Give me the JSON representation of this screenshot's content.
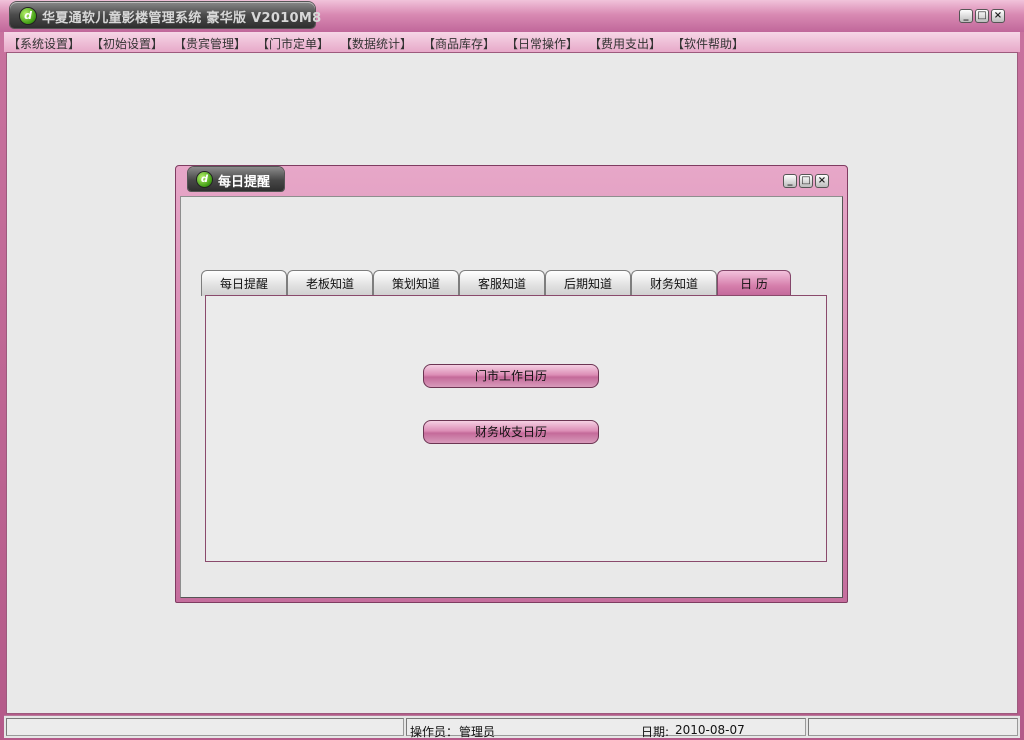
{
  "app": {
    "title": "华夏通软儿童影楼管理系统 豪华版 V2010M8",
    "accent": "#c56e9d"
  },
  "menu": {
    "items": [
      "【系统设置】",
      "【初始设置】",
      "【贵宾管理】",
      "【门市定单】",
      "【数据统计】",
      "【商品库存】",
      "【日常操作】",
      "【费用支出】",
      "【软件帮助】"
    ]
  },
  "dialog": {
    "title": "每日提醒",
    "tabs": [
      "每日提醒",
      "老板知道",
      "策划知道",
      "客服知道",
      "后期知道",
      "财务知道",
      "日 历"
    ],
    "active_tab": "日 历",
    "buttons": {
      "store_calendar": "门市工作日历",
      "finance_calendar": "财务收支日历"
    }
  },
  "status": {
    "operator_label": "操作员：",
    "operator_value": "管理员",
    "date_label": "日期:",
    "date_value": "2010-08-07"
  },
  "icons": {
    "app_logo": "app-logo-icon",
    "minimize": "minimize-icon",
    "maximize": "maximize-icon",
    "close": "close-icon"
  }
}
